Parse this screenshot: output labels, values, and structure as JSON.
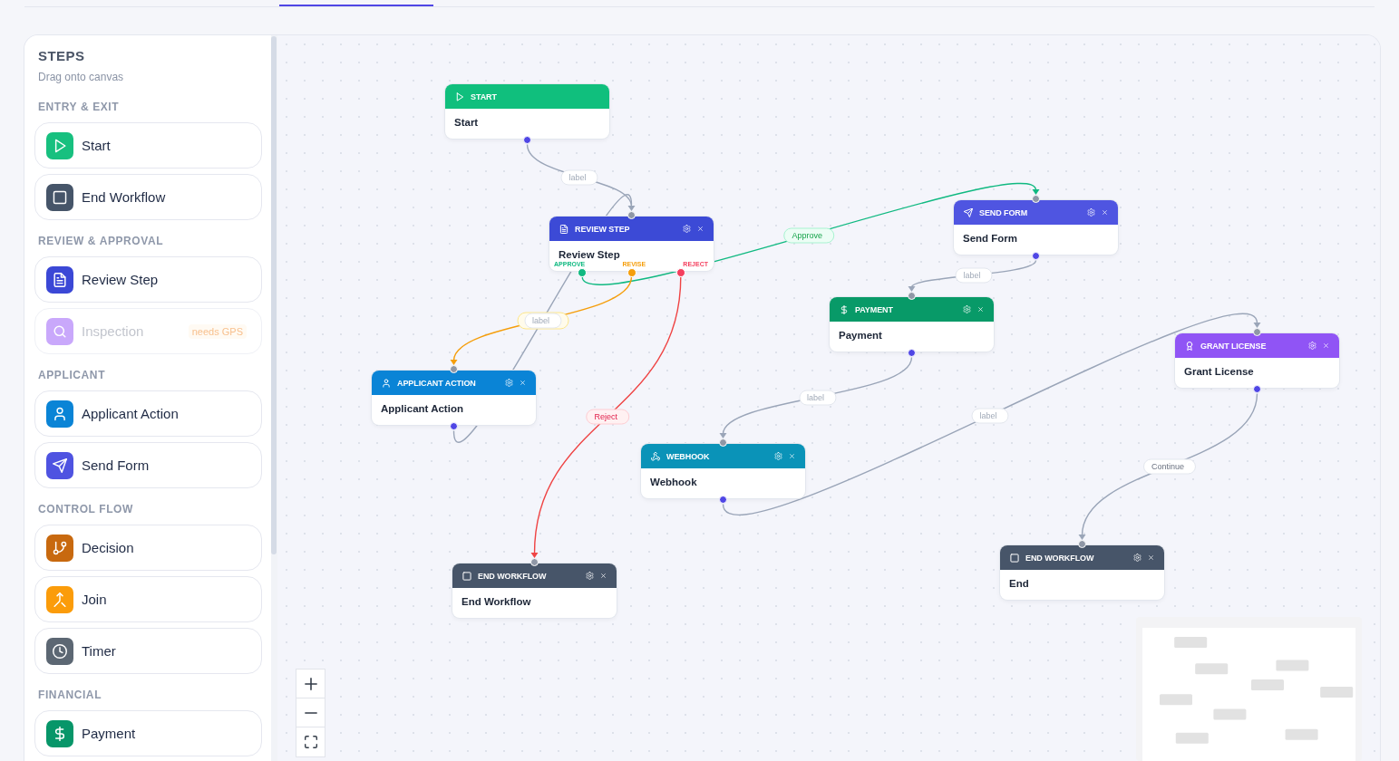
{
  "tabs": [
    {
      "selected": false
    },
    {
      "selected": true
    }
  ],
  "sidebar": {
    "title": "STEPS",
    "subtitle": "Drag onto canvas",
    "sections": [
      {
        "title": "ENTRY & EXIT",
        "items": [
          {
            "kind": "start",
            "label": "Start",
            "color": "#17c07f",
            "disabled": false
          },
          {
            "kind": "end",
            "label": "End Workflow",
            "color": "#465569",
            "disabled": false
          }
        ]
      },
      {
        "title": "REVIEW & APPROVAL",
        "items": [
          {
            "kind": "review",
            "label": "Review Step",
            "color": "#3b48d6",
            "disabled": false
          },
          {
            "kind": "inspection",
            "label": "Inspection",
            "color": "#c9a8fb",
            "disabled": true,
            "badge": "needs GPS"
          }
        ]
      },
      {
        "title": "APPLICANT",
        "items": [
          {
            "kind": "applicant",
            "label": "Applicant Action",
            "color": "#0a84d6",
            "disabled": false
          },
          {
            "kind": "send_form",
            "label": "Send Form",
            "color": "#4f53e1",
            "disabled": false
          }
        ]
      },
      {
        "title": "CONTROL FLOW",
        "items": [
          {
            "kind": "decision",
            "label": "Decision",
            "color": "#c8690f",
            "disabled": false
          },
          {
            "kind": "join",
            "label": "Join",
            "color": "#fb9c0a",
            "disabled": false
          },
          {
            "kind": "timer",
            "label": "Timer",
            "color": "#5c6773",
            "disabled": false
          }
        ]
      },
      {
        "title": "FINANCIAL",
        "items": [
          {
            "kind": "payment",
            "label": "Payment",
            "color": "#079669",
            "disabled": false
          }
        ]
      }
    ]
  },
  "canvas": {
    "nodes": [
      {
        "kind": "start",
        "header": "START",
        "title": "Start",
        "color": "#10bf7d",
        "actions": false
      },
      {
        "kind": "send_form",
        "header": "SEND FORM",
        "title": "Send Form",
        "color": "#4f55e1",
        "actions": true
      },
      {
        "kind": "review",
        "header": "REVIEW STEP",
        "title": "Review Step",
        "color": "#3c4ad6",
        "actions": true,
        "ports": [
          {
            "label": "APPROVE",
            "color": "#10b981"
          },
          {
            "label": "REVISE",
            "color": "#f59e0b"
          },
          {
            "label": "REJECT",
            "color": "#f43f5e"
          }
        ]
      },
      {
        "kind": "payment",
        "header": "PAYMENT",
        "title": "Payment",
        "color": "#089a68",
        "actions": true
      },
      {
        "kind": "grant_license",
        "header": "GRANT LICENSE",
        "title": "Grant License",
        "color": "#9054f5",
        "actions": true
      },
      {
        "kind": "applicant",
        "header": "APPLICANT ACTION",
        "title": "Applicant Action",
        "color": "#0a84d6",
        "actions": true
      },
      {
        "kind": "webhook",
        "header": "WEBHOOK",
        "title": "Webhook",
        "color": "#0a93b8",
        "actions": true
      },
      {
        "kind": "end",
        "header": "END WORKFLOW",
        "title": "End",
        "color": "#475569",
        "actions": true
      },
      {
        "kind": "end",
        "header": "END WORKFLOW",
        "title": "End Workflow",
        "color": "#475569",
        "actions": true
      }
    ],
    "edges": [
      {
        "kind": "default",
        "label_box": true,
        "placeholder": "label"
      },
      {
        "kind": "approve",
        "label_box": true,
        "label": "Approve"
      },
      {
        "kind": "default",
        "label_box": true,
        "placeholder": "label"
      },
      {
        "kind": "revise",
        "label_box": true
      },
      {
        "kind": "default",
        "label_box": true,
        "placeholder": "label"
      },
      {
        "kind": "reject",
        "label_box": true,
        "label": "Reject"
      },
      {
        "kind": "default",
        "label_box": true,
        "placeholder": "label"
      },
      {
        "kind": "default",
        "label_box": true,
        "placeholder": "label"
      },
      {
        "kind": "default",
        "label_box": true,
        "label": "Continue"
      }
    ]
  }
}
